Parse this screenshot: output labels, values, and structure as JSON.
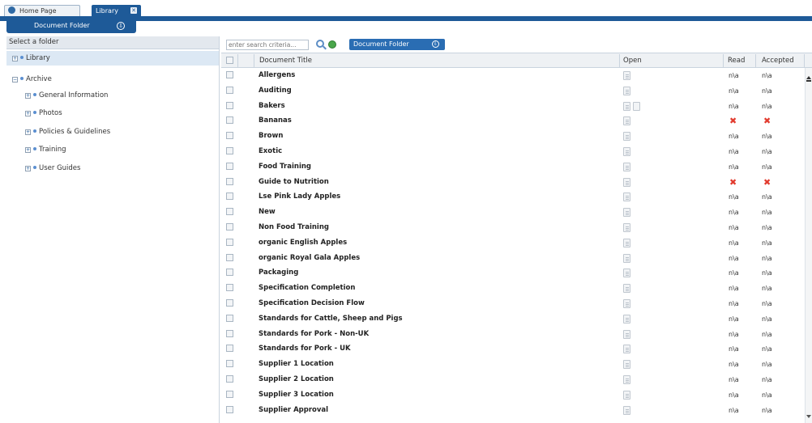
{
  "tabs": [
    {
      "label": "Home Page",
      "icon": "globe-icon"
    },
    {
      "label": "Library",
      "icon": "close-icon"
    }
  ],
  "folder_button": {
    "label": "Document Folder"
  },
  "left_panel": {
    "header": "Select a folder",
    "tree": [
      {
        "label": "Library",
        "selected": true
      },
      {
        "label": "Archive"
      },
      {
        "label": "General Information"
      },
      {
        "label": "Photos"
      },
      {
        "label": "Policies & Guidelines"
      },
      {
        "label": "Training"
      },
      {
        "label": "User Guides"
      }
    ]
  },
  "toolbar": {
    "search_placeholder": "enter search criteria...",
    "dropdown_label": "Document Folder"
  },
  "table": {
    "columns": [
      "Document Title",
      "Open",
      "Read",
      "Accepted"
    ],
    "rows": [
      {
        "title": "Allergens",
        "read": "n\\a",
        "accepted": "n\\a"
      },
      {
        "title": "Auditing",
        "read": "n\\a",
        "accepted": "n\\a"
      },
      {
        "title": "Bakers",
        "read": "n\\a",
        "accepted": "n\\a"
      },
      {
        "title": "Bananas",
        "read": "✖",
        "accepted": "✖"
      },
      {
        "title": "Brown",
        "read": "n\\a",
        "accepted": "n\\a"
      },
      {
        "title": "Exotic",
        "read": "n\\a",
        "accepted": "n\\a"
      },
      {
        "title": "Food Training",
        "read": "n\\a",
        "accepted": "n\\a"
      },
      {
        "title": "Guide to Nutrition",
        "read": "✖",
        "accepted": "✖"
      },
      {
        "title": "Lse Pink Lady Apples",
        "read": "n\\a",
        "accepted": "n\\a"
      },
      {
        "title": "New",
        "read": "n\\a",
        "accepted": "n\\a"
      },
      {
        "title": "Non Food Training",
        "read": "n\\a",
        "accepted": "n\\a"
      },
      {
        "title": "organic English Apples",
        "read": "n\\a",
        "accepted": "n\\a"
      },
      {
        "title": "organic Royal Gala Apples",
        "read": "n\\a",
        "accepted": "n\\a"
      },
      {
        "title": "Packaging",
        "read": "n\\a",
        "accepted": "n\\a"
      },
      {
        "title": "Specification Completion",
        "read": "n\\a",
        "accepted": "n\\a"
      },
      {
        "title": "Specification Decision Flow",
        "read": "n\\a",
        "accepted": "n\\a"
      },
      {
        "title": "Standards for Cattle, Sheep and Pigs",
        "read": "n\\a",
        "accepted": "n\\a"
      },
      {
        "title": "Standards for Pork - Non-UK",
        "read": "n\\a",
        "accepted": "n\\a"
      },
      {
        "title": "Standards for Pork - UK",
        "read": "n\\a",
        "accepted": "n\\a"
      },
      {
        "title": "Supplier 1 Location",
        "read": "n\\a",
        "accepted": "n\\a"
      },
      {
        "title": "Supplier 2 Location",
        "read": "n\\a",
        "accepted": "n\\a"
      },
      {
        "title": "Supplier 3 Location",
        "read": "n\\a",
        "accepted": "n\\a"
      },
      {
        "title": "Supplier Approval",
        "read": "n\\a",
        "accepted": "n\\a"
      }
    ]
  },
  "colors": {
    "accent": "#1e5a98",
    "reject": "#e23b2e"
  }
}
